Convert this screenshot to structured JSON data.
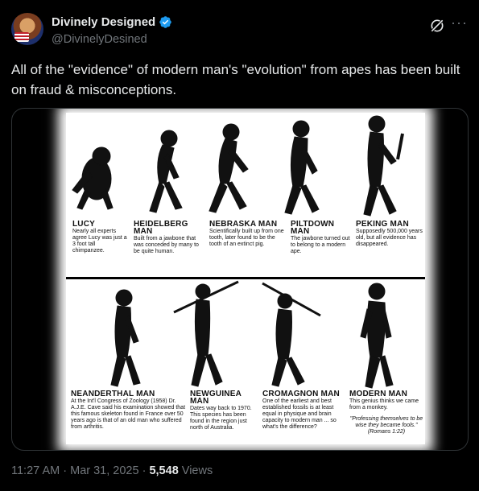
{
  "author": {
    "display_name": "Divinely Designed",
    "handle": "@DivinelyDesined",
    "verified_color": "#1d9bf0"
  },
  "icons": {
    "grok": "grok-icon",
    "more": "more-icon",
    "verified": "verified-badge-icon"
  },
  "tweet": {
    "text": "All of the \"evidence\" of modern man's \"evolution\" from apes has been built on fraud & misconceptions."
  },
  "image": {
    "top_row": [
      {
        "title": "LUCY",
        "body": "Nearly all experts agree Lucy was just a 3 foot tall chimpanzee."
      },
      {
        "title": "HEIDELBERG MAN",
        "body": "Built from a jawbone that was conceded by many to be quite human."
      },
      {
        "title": "NEBRASKA MAN",
        "body": "Scientifically built up from one tooth, later found to be the tooth of an extinct pig."
      },
      {
        "title": "PILTDOWN MAN",
        "body": "The jawbone turned out to belong to a modern ape."
      },
      {
        "title": "PEKING MAN",
        "body": "Supposedly 500,000 years old, but all evidence has disappeared."
      }
    ],
    "bottom_row": [
      {
        "title": "NEANDERTHAL MAN",
        "body": "At the Int'l Congress of Zoology (1958) Dr. A.J.E. Cave said his examination showed that this famous skeleton found in France over 50 years ago is that of an old man who suffered from arthritis."
      },
      {
        "title": "NEWGUINEA MAN",
        "body": "Dates way back to 1970. This species has been found in the region just north of Australia."
      },
      {
        "title": "CROMAGNON MAN",
        "body": "One of the earliest and best established fossils is at least equal in physique and brain capacity to modern man ... so what's the difference?"
      },
      {
        "title": "MODERN MAN",
        "body": "This genius thinks we came from a monkey."
      }
    ],
    "quote": "\"Professing themselves to be wise they became fools.\" (Romans 1:22)"
  },
  "meta": {
    "time": "11:27 AM",
    "date": "Mar 31, 2025",
    "separator": "·",
    "views_count": "5,548",
    "views_label": "Views"
  }
}
